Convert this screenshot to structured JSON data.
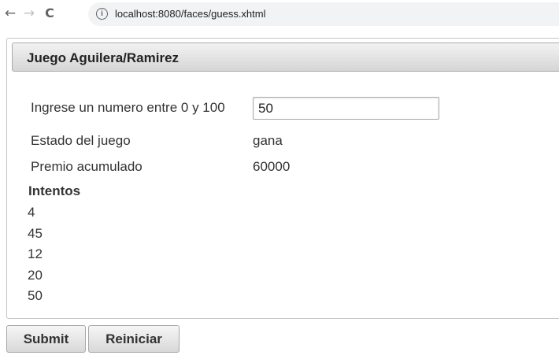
{
  "browser": {
    "back_glyph": "←",
    "forward_glyph": "→",
    "reload_glyph": "C",
    "info_glyph": "i",
    "url": "localhost:8080/faces/guess.xhtml"
  },
  "panel": {
    "title": "Juego Aguilera/Ramirez"
  },
  "form": {
    "guess_label": "Ingrese un numero entre 0 y 100",
    "guess_value": "50",
    "status_label": "Estado del juego",
    "status_value": "gana",
    "prize_label": "Premio acumulado",
    "prize_value": "60000"
  },
  "attempts": {
    "title": "Intentos",
    "items": [
      "4",
      "45",
      "12",
      "20",
      "50"
    ]
  },
  "buttons": {
    "submit_label": "Submit",
    "reset_label": "Reiniciar"
  }
}
